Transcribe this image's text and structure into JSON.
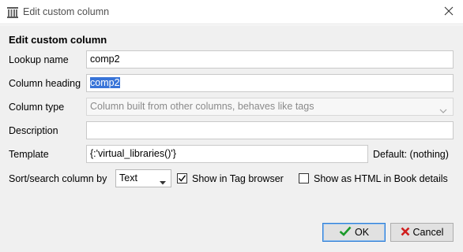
{
  "window": {
    "title": "Edit custom column",
    "close_icon": "close-icon",
    "app_icon": "calibre-library-icon"
  },
  "form": {
    "heading": "Edit custom column",
    "lookup_name": {
      "label": "Lookup name",
      "value": "comp2"
    },
    "column_heading": {
      "label": "Column heading",
      "value": "comp2"
    },
    "column_type": {
      "label": "Column type",
      "value": "Column built from other columns, behaves like tags"
    },
    "description": {
      "label": "Description",
      "value": ""
    },
    "template": {
      "label": "Template",
      "value": "{:'virtual_libraries()'}",
      "default_label": "Default: (nothing)"
    },
    "sort_search": {
      "label": "Sort/search column by",
      "value": "Text"
    },
    "show_in_tag_browser": {
      "label": "Show in Tag browser",
      "checked": true
    },
    "show_as_html": {
      "label": "Show as HTML in Book details",
      "checked": false
    }
  },
  "buttons": {
    "ok_label": "OK",
    "cancel_label": "Cancel"
  },
  "colors": {
    "selection": "#3874d8",
    "ok_check": "#1a9a2a",
    "cancel_x": "#d01f1f",
    "dialog_bg": "#f0f0f0"
  }
}
